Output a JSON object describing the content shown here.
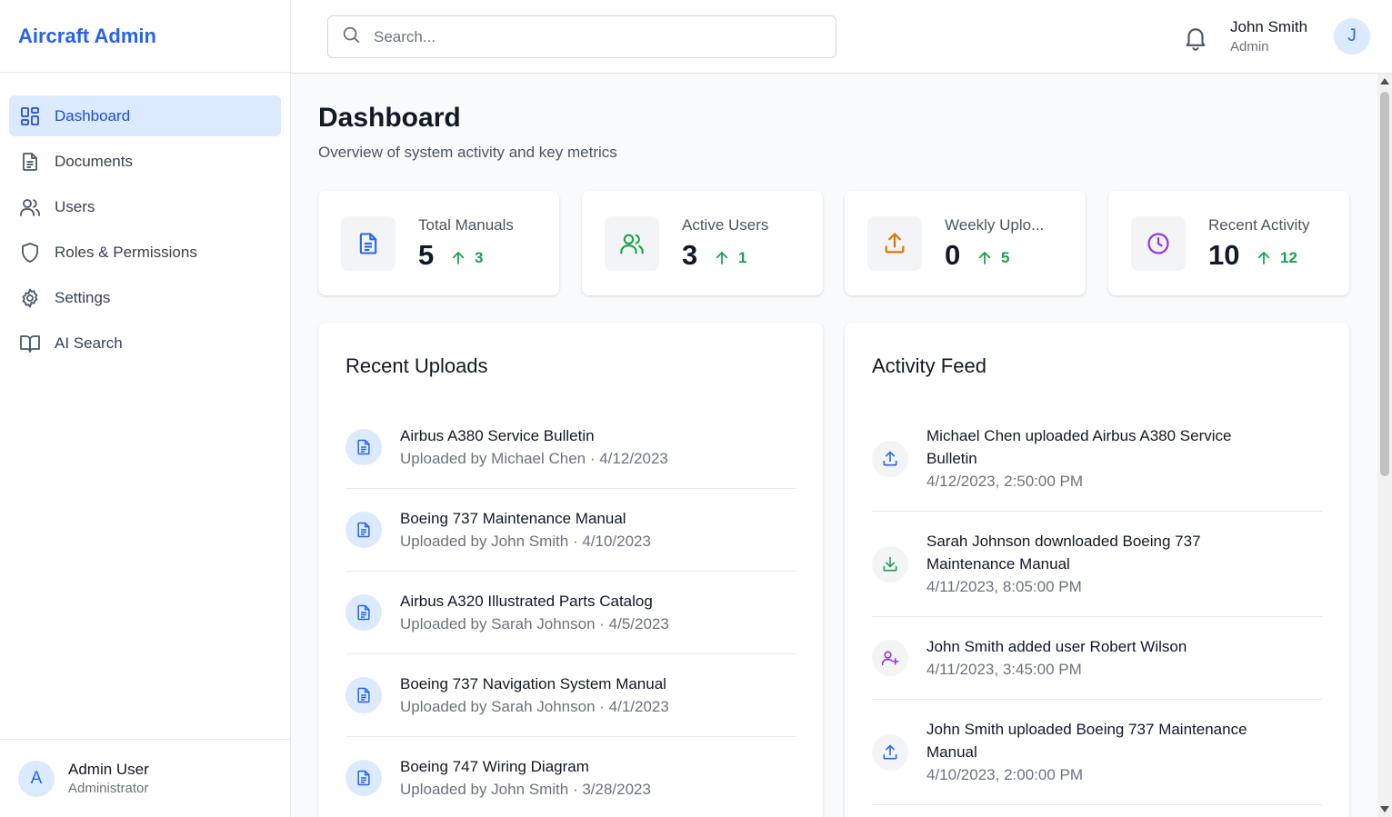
{
  "app": {
    "title": "Aircraft Admin",
    "accent": "#2563eb"
  },
  "sidebar": {
    "items": [
      {
        "label": "Dashboard",
        "icon": "dashboard-icon",
        "active": true
      },
      {
        "label": "Documents",
        "icon": "document-icon",
        "active": false
      },
      {
        "label": "Users",
        "icon": "users-icon",
        "active": false
      },
      {
        "label": "Roles & Permissions",
        "icon": "shield-icon",
        "active": false
      },
      {
        "label": "Settings",
        "icon": "gear-icon",
        "active": false
      },
      {
        "label": "AI Search",
        "icon": "book-icon",
        "active": false
      }
    ],
    "user": {
      "initial": "A",
      "name": "Admin User",
      "role": "Administrator"
    }
  },
  "header": {
    "search": {
      "placeholder": "Search...",
      "value": ""
    },
    "user": {
      "name": "John Smith",
      "role": "Admin",
      "initial": "J"
    }
  },
  "page": {
    "title": "Dashboard",
    "subtitle": "Overview of system activity and key metrics"
  },
  "stats": [
    {
      "label": "Total Manuals",
      "value": "5",
      "trend": "3",
      "icon": "document-icon",
      "color": "#2563eb"
    },
    {
      "label": "Active Users",
      "value": "3",
      "trend": "1",
      "icon": "users-icon",
      "color": "#16a34a"
    },
    {
      "label": "Weekly Uplo...",
      "value": "0",
      "trend": "5",
      "icon": "upload-icon",
      "color": "#d97706"
    },
    {
      "label": "Recent Activity",
      "value": "10",
      "trend": "12",
      "icon": "clock-icon",
      "color": "#9333ea"
    }
  ],
  "recent_uploads": {
    "title": "Recent Uploads",
    "items": [
      {
        "title": "Airbus A380 Service Bulletin",
        "meta": "Uploaded by Michael Chen · 4/12/2023"
      },
      {
        "title": "Boeing 737 Maintenance Manual",
        "meta": "Uploaded by John Smith · 4/10/2023"
      },
      {
        "title": "Airbus A320 Illustrated Parts Catalog",
        "meta": "Uploaded by Sarah Johnson · 4/5/2023"
      },
      {
        "title": "Boeing 737 Navigation System Manual",
        "meta": "Uploaded by Sarah Johnson · 4/1/2023"
      },
      {
        "title": "Boeing 747 Wiring Diagram",
        "meta": "Uploaded by John Smith · 3/28/2023"
      }
    ]
  },
  "activity_feed": {
    "title": "Activity Feed",
    "items": [
      {
        "line1": "Michael Chen uploaded Airbus A380 Service",
        "line2": "Bulletin",
        "time": "4/12/2023, 2:50:00 PM",
        "icon": "upload-icon",
        "color": "#2563eb"
      },
      {
        "line1": "Sarah Johnson downloaded Boeing 737",
        "line2": "Maintenance Manual",
        "time": "4/11/2023, 8:05:00 PM",
        "icon": "download-icon",
        "color": "#16a34a"
      },
      {
        "line1": "John Smith added user Robert Wilson",
        "line2": "",
        "time": "4/11/2023, 3:45:00 PM",
        "icon": "user-plus-icon",
        "color": "#9333ea"
      },
      {
        "line1": "John Smith uploaded Boeing 737 Maintenance",
        "line2": "Manual",
        "time": "4/10/2023, 2:00:00 PM",
        "icon": "upload-icon",
        "color": "#2563eb"
      }
    ]
  }
}
